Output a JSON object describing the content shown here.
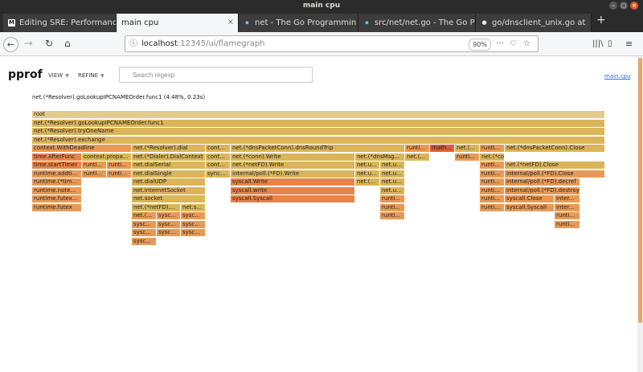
{
  "window": {
    "title": "main cpu"
  },
  "tabs": [
    {
      "label": "Editing SRE: Performanc",
      "favicon": "M",
      "favicon_color": "#1a1a1a",
      "active": false
    },
    {
      "label": "main cpu",
      "favicon": "",
      "favicon_color": "",
      "active": true
    },
    {
      "label": "net - The Go Programmin",
      "favicon": "▪",
      "favicon_color": "#5dc9e2",
      "active": false
    },
    {
      "label": "src/net/net.go - The Go P",
      "favicon": "▪",
      "favicon_color": "#5dc9e2",
      "active": false
    },
    {
      "label": "go/dnsclient_unix.go at",
      "favicon": "●",
      "favicon_color": "#e8e8e8",
      "active": false
    }
  ],
  "navbar": {
    "url_host": "localhost",
    "url_rest": ":12345/ui/flamegraph",
    "zoom": "90%"
  },
  "pprof": {
    "title": "pprof",
    "menu_view": "VIEW",
    "menu_refine": "REFINE",
    "search_placeholder": "Search regexp",
    "filename": "main.cpu",
    "hover_detail": "net.(*Resolver).goLookupIPCNAMEOrder.func1 (4.48%, 0.23s)"
  },
  "colors": {
    "root": "#e2c98f",
    "warm": "#dcb55a",
    "orange": "#e89a55",
    "deep": "#e8834a",
    "red": "#e25a3c"
  },
  "flame_rows": [
    [
      {
        "label": "root",
        "c": "root"
      }
    ],
    [
      {
        "label": "net.(*Resolver).goLookupIPCNAMEOrder.func1",
        "c": "warm"
      }
    ],
    [
      {
        "label": "net.(*Resolver).tryOneName",
        "c": "warm"
      }
    ],
    [
      {
        "label": "net.(*Resolver).exchange",
        "c": "warm"
      }
    ],
    [
      {
        "label": "context.WithDeadline",
        "c": "orange"
      },
      {
        "label": "net.(*Resolver).dial",
        "c": "warm"
      },
      {
        "label": "cont...",
        "c": "warm"
      },
      {
        "label": "net.(*dnsPacketConn).dnsRoundTrip",
        "c": "warm"
      },
      {
        "label": "runti...",
        "c": "orange"
      },
      {
        "label": "math...",
        "c": "red"
      },
      {
        "label": "net.(...",
        "c": "warm"
      },
      {
        "label": "runti...",
        "c": "orange"
      },
      {
        "label": "net.(*dnsPacketConn).Close",
        "c": "warm"
      }
    ],
    [
      {
        "label": "time.AfterFunc",
        "c": "deep"
      },
      {
        "label": "context.propa...",
        "c": "warm"
      },
      {
        "label": "net.(*Dialer).DialContext",
        "c": "warm"
      },
      {
        "label": "cont...",
        "c": "warm"
      },
      {
        "label": "net.(*conn).Write",
        "c": "warm"
      },
      {
        "label": "net.(*dnsMsg...",
        "c": "warm"
      },
      {
        "label": "net.(...",
        "c": "warm"
      },
      {
        "label": "runti...",
        "c": "orange"
      },
      {
        "label": "net.(*conn).Close",
        "c": "warm"
      }
    ],
    [
      {
        "label": "time.startTimer",
        "c": "deep"
      },
      {
        "label": "runti...",
        "c": "orange"
      },
      {
        "label": "runti...",
        "c": "orange"
      },
      {
        "label": "net.dialSerial",
        "c": "warm"
      },
      {
        "label": "cont...",
        "c": "warm"
      },
      {
        "label": "net.(*netFD).Write",
        "c": "warm"
      },
      {
        "label": "net.u...",
        "c": "warm"
      },
      {
        "label": "net.u...",
        "c": "warm"
      },
      {
        "label": "runti...",
        "c": "orange"
      },
      {
        "label": "net.(*netFD).Close",
        "c": "warm"
      }
    ],
    [
      {
        "label": "runtime.addti...",
        "c": "orange"
      },
      {
        "label": "runti...",
        "c": "orange"
      },
      {
        "label": "runti...",
        "c": "orange"
      },
      {
        "label": "net.dialSingle",
        "c": "warm"
      },
      {
        "label": "sync...",
        "c": "warm"
      },
      {
        "label": "internal/poll.(*FD).Write",
        "c": "warm"
      },
      {
        "label": "net.u...",
        "c": "warm"
      },
      {
        "label": "net.u...",
        "c": "warm"
      },
      {
        "label": "runti...",
        "c": "orange"
      },
      {
        "label": "internal/poll.(*FD).Close",
        "c": "orange"
      }
    ],
    [
      {
        "label": "runtime.(*tim...",
        "c": "orange"
      },
      {
        "label": "net.dialUDP",
        "c": "warm"
      },
      {
        "label": "syscall.Write",
        "c": "deep"
      },
      {
        "label": "net.(...",
        "c": "warm"
      },
      {
        "label": "net.u...",
        "c": "warm"
      },
      {
        "label": "runti...",
        "c": "orange"
      },
      {
        "label": "internal/poll.(*FD).decref",
        "c": "orange"
      }
    ],
    [
      {
        "label": "runtime.note...",
        "c": "orange"
      },
      {
        "label": "net.internetSocket",
        "c": "warm"
      },
      {
        "label": "syscall.write",
        "c": "deep"
      },
      {
        "label": "net.u...",
        "c": "warm"
      },
      {
        "label": "runti...",
        "c": "orange"
      },
      {
        "label": "internal/poll.(*FD).destroy",
        "c": "orange"
      }
    ],
    [
      {
        "label": "runtime.futex...",
        "c": "orange"
      },
      {
        "label": "net.socket",
        "c": "warm"
      },
      {
        "label": "syscall.Syscall",
        "c": "deep"
      },
      {
        "label": "runti...",
        "c": "orange"
      },
      {
        "label": "runti...",
        "c": "orange"
      },
      {
        "label": "syscall.Close",
        "c": "orange"
      },
      {
        "label": "inter...",
        "c": "orange"
      }
    ],
    [
      {
        "label": "runtime.futex",
        "c": "orange"
      },
      {
        "label": "net.(*netFD)....",
        "c": "warm"
      },
      {
        "label": "net.s...",
        "c": "warm"
      },
      {
        "label": "runti...",
        "c": "orange"
      },
      {
        "label": "runti...",
        "c": "orange"
      },
      {
        "label": "syscall.Syscall",
        "c": "orange"
      },
      {
        "label": "inter...",
        "c": "orange"
      }
    ],
    [
      {
        "label": "net.(...",
        "c": "orange"
      },
      {
        "label": "sysc...",
        "c": "orange"
      },
      {
        "label": "sysc...",
        "c": "orange"
      },
      {
        "label": "runti...",
        "c": "orange"
      },
      {
        "label": "runti...",
        "c": "orange"
      }
    ],
    [
      {
        "label": "sysc...",
        "c": "orange"
      },
      {
        "label": "sysc...",
        "c": "orange"
      },
      {
        "label": "sysc...",
        "c": "orange"
      },
      {
        "label": "runti...",
        "c": "orange"
      }
    ],
    [
      {
        "label": "sysc...",
        "c": "orange"
      },
      {
        "label": "sysc...",
        "c": "orange"
      },
      {
        "label": "sysc...",
        "c": "orange"
      }
    ],
    [
      {
        "label": "sysc...",
        "c": "orange"
      }
    ]
  ]
}
